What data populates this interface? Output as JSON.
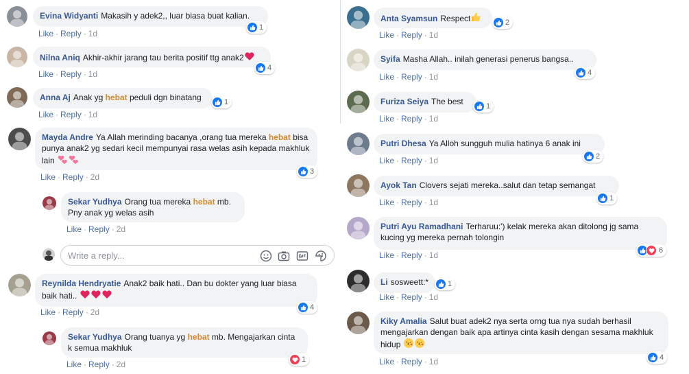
{
  "actions": {
    "like": "Like",
    "reply": "Reply",
    "sep": "·"
  },
  "left": [
    {
      "name": "Evina Widyanti",
      "parts": [
        "Makasih y adek2,, luar biasa buat kalian."
      ],
      "time": "1d",
      "reactions": [
        "like"
      ],
      "count": "1"
    },
    {
      "name": "Nilna Aniq",
      "parts": [
        "Akhir-akhir jarang tau berita positif ttg anak2"
      ],
      "emoji": [
        "red-heart"
      ],
      "time": "1d",
      "reactions": [
        "like"
      ],
      "count": "4"
    },
    {
      "name": "Anna Aj",
      "parts": [
        "Anak yg ",
        "hebat",
        " peduli dgn binatang"
      ],
      "time": "1d",
      "reactions": [
        "like"
      ],
      "count": "1"
    },
    {
      "name": "Mayda Andre",
      "parts": [
        "Ya Allah merinding bacanya ,orang tua mereka ",
        "hebat",
        " bisa punya anak2 yg sedari kecil mempunyai rasa welas asih kepada makhluk lain "
      ],
      "emoji": [
        "two-hearts",
        "two-hearts"
      ],
      "time": "2d",
      "reactions": [
        "like"
      ],
      "count": "3"
    },
    {
      "name": "Sekar Yudhya",
      "parts": [
        "Orang tua mereka ",
        "hebat",
        " mb. Pny anak yg welas asih"
      ],
      "time": "2d",
      "reactions": [],
      "count": ""
    },
    {
      "name": "Reynilda Hendryatie",
      "parts": [
        "Anak2 baik hati.. Dan bu dokter yang luar biasa baik hati.. "
      ],
      "emoji": [
        "red-heart",
        "red-heart",
        "red-heart"
      ],
      "time": "2d",
      "reactions": [
        "like"
      ],
      "count": "4"
    },
    {
      "name": "Sekar Yudhya",
      "parts": [
        "Orang tuanya yg ",
        "hebat",
        " mb. Mengajarkan cinta k semua makhluk"
      ],
      "time": "2d",
      "reactions": [
        "love"
      ],
      "count": "1"
    }
  ],
  "right": [
    {
      "name": "Anta Syamsun",
      "parts": [
        "Respect"
      ],
      "emoji": [
        "thumbs-up"
      ],
      "time": "1d",
      "reactions": [
        "like"
      ],
      "count": "2"
    },
    {
      "name": "Syifa",
      "parts": [
        "Masha Allah.. inilah generasi penerus bangsa.."
      ],
      "time": "1d",
      "reactions": [
        "like"
      ],
      "count": "4"
    },
    {
      "name": "Furiza Seiya",
      "parts": [
        "The best"
      ],
      "time": "1d",
      "reactions": [
        "like"
      ],
      "count": "1"
    },
    {
      "name": "Putri Dhesa",
      "parts": [
        "Ya Alloh sungguh mulia hatinya 6 anak ini"
      ],
      "time": "1d",
      "reactions": [
        "like"
      ],
      "count": "2"
    },
    {
      "name": "Ayok Tan",
      "parts": [
        "Clovers sejati mereka..salut dan tetap semangat"
      ],
      "time": "1d",
      "reactions": [
        "like"
      ],
      "count": "1"
    },
    {
      "name": "Putri Ayu Ramadhani",
      "parts": [
        "Terharuu:') kelak mereka akan ditolong jg sama kucing yg mereka pernah tolongin"
      ],
      "time": "1d",
      "reactions": [
        "like",
        "love"
      ],
      "count": "6"
    },
    {
      "name": "Li",
      "parts": [
        "sosweett:*"
      ],
      "time": "1d",
      "reactions": [
        "like"
      ],
      "count": "1"
    },
    {
      "name": "Kiky Amalia",
      "parts": [
        "Salut buat adek2 nya serta orng tua nya sudah berhasil mengajarkan dengan baik apa artinya cinta kasih dengan sesama makhluk hidup "
      ],
      "emoji": [
        "kiss-face",
        "kiss-face"
      ],
      "time": "1d",
      "reactions": [
        "like"
      ],
      "count": "4"
    }
  ],
  "reply_box": {
    "placeholder": "Write a reply...",
    "icons": [
      "emoji-icon",
      "camera-icon",
      "gif-icon",
      "sticker-icon"
    ]
  },
  "colors": {
    "name": "#385898",
    "highlight": "#d8882a",
    "bubble": "#f2f3f5",
    "like": "#1877f2",
    "love": "#f33e58"
  }
}
